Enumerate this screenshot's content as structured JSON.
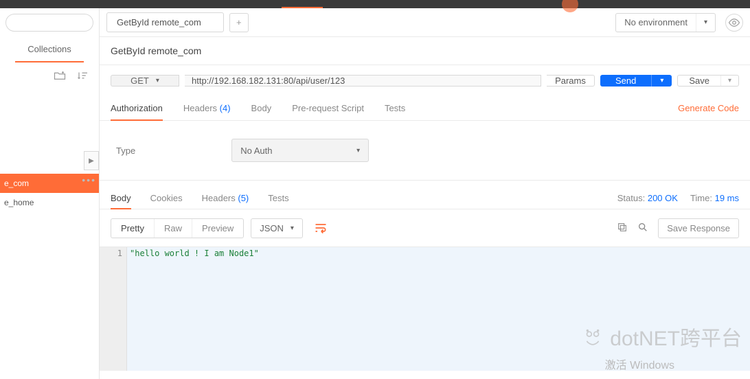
{
  "sidebar": {
    "collections_label": "Collections",
    "items": [
      {
        "label": "e_com",
        "active": true
      },
      {
        "label": "e_home",
        "active": false
      }
    ]
  },
  "tabs": {
    "open": "GetById remote_com"
  },
  "environment": {
    "label": "No environment"
  },
  "request": {
    "name": "GetById remote_com",
    "method": "GET",
    "url": "http://192.168.182.131:80/api/user/123",
    "params_label": "Params",
    "send_label": "Send",
    "save_label": "Save",
    "tabs": {
      "authorization": "Authorization",
      "headers": "Headers",
      "headers_count": "(4)",
      "body": "Body",
      "prerequest": "Pre-request Script",
      "tests": "Tests"
    },
    "generate_code": "Generate Code",
    "auth": {
      "type_label": "Type",
      "selected": "No Auth"
    }
  },
  "response": {
    "tabs": {
      "body": "Body",
      "cookies": "Cookies",
      "headers": "Headers",
      "headers_count": "(5)",
      "tests": "Tests"
    },
    "status_label": "Status:",
    "status_value": "200 OK",
    "time_label": "Time:",
    "time_value": "19 ms",
    "view": {
      "pretty": "Pretty",
      "raw": "Raw",
      "preview": "Preview",
      "format": "JSON"
    },
    "save_response": "Save Response",
    "body_text": "\"hello world ! I am Node1\"",
    "line_no": "1"
  },
  "watermark": "dotNET跨平台",
  "activate": "激活 Windows"
}
